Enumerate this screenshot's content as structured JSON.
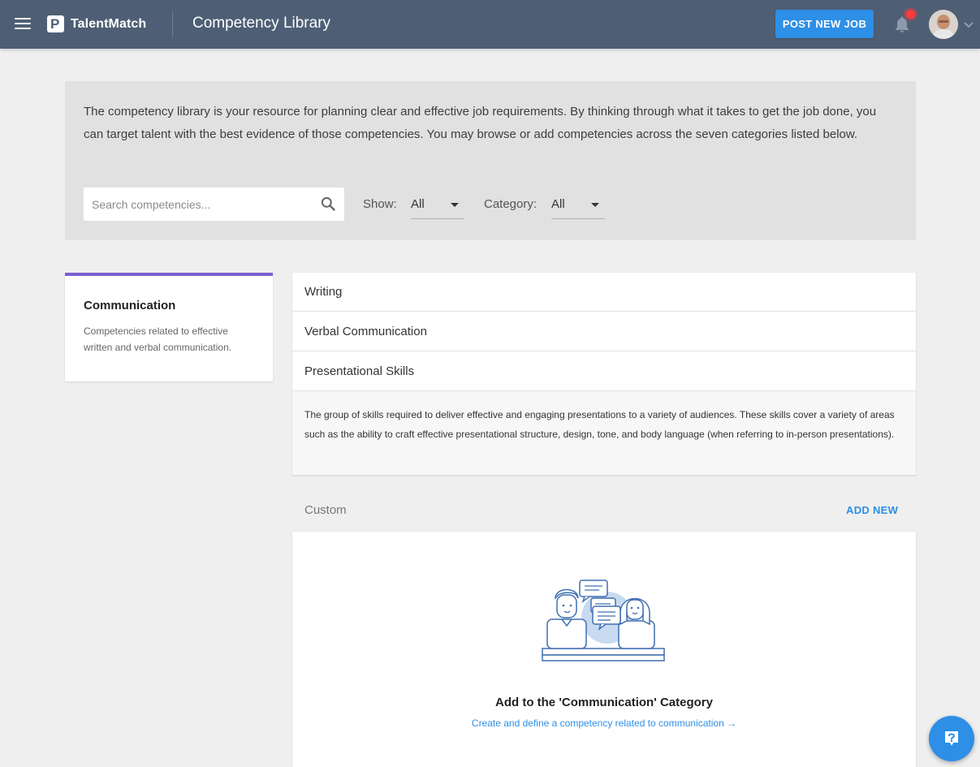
{
  "header": {
    "menu_icon": "hamburger-menu-icon",
    "brand": "TalentMatch",
    "title": "Competency Library",
    "post_job_label": "POST NEW JOB",
    "notification_icon": "bell-icon",
    "avatar_chevron_icon": "chevron-down-icon",
    "colors": {
      "bar": "#4e5f75",
      "accent": "#2d8fe6",
      "badge": "#ff3b3b"
    }
  },
  "intro": {
    "text": "The competency library is your resource for planning clear and effective job requirements. By thinking through what it takes to get the job done, you can target talent with the best evidence of those competencies. You may browse or add competencies across the seven categories listed below.",
    "search_placeholder": "Search competencies...",
    "search_value": "",
    "show_label": "Show:",
    "show_value": "All",
    "category_label": "Category:",
    "category_value": "All"
  },
  "category": {
    "title": "Communication",
    "description": "Competencies related to effective written and verbal communication.",
    "accent_color": "#7b5fd1"
  },
  "competencies": [
    {
      "label": "Writing"
    },
    {
      "label": "Verbal Communication"
    },
    {
      "label": "Presentational Skills"
    }
  ],
  "selected_detail": "The group of skills required to deliver effective and engaging presentations to a variety of audiences. These skills cover a variety of areas such as the ability to craft effective presentational structure, design, tone, and body language (when referring to in-person presentations).",
  "custom": {
    "label": "Custom",
    "add_new_label": "ADD NEW",
    "empty_title": "Add to the 'Communication' Category",
    "empty_link": "Create and define a competency related to communication →"
  },
  "help_icon": "help-question-icon"
}
